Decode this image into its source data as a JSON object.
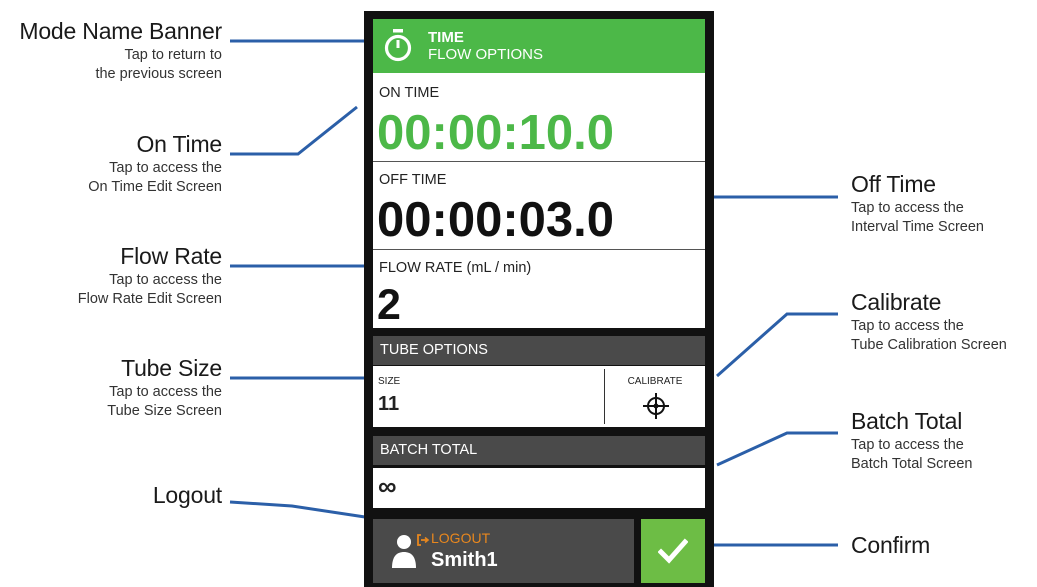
{
  "device": {
    "banner": {
      "mode": "TIME",
      "subtitle": "FLOW OPTIONS",
      "icon": "stopwatch-icon"
    },
    "on_time": {
      "label": "ON TIME",
      "value": "00:00:10.0",
      "color": "#4cb848"
    },
    "off_time": {
      "label": "OFF TIME",
      "value": "00:00:03.0"
    },
    "flow_rate": {
      "label": "FLOW RATE (mL / min)",
      "value": "2"
    },
    "tube_options": {
      "header": "TUBE OPTIONS",
      "size_label": "SIZE",
      "size_value": "11",
      "calibrate_label": "CALIBRATE",
      "calibrate_icon": "crosshair-icon"
    },
    "batch_total": {
      "header": "BATCH TOTAL",
      "value": "∞"
    },
    "logout": {
      "label": "LOGOUT",
      "user": "Smith1",
      "icon": "user-logout-icon",
      "label_color": "#e8871e"
    },
    "confirm": {
      "icon": "checkmark-icon",
      "color": "#6dbd45"
    }
  },
  "callouts": {
    "mode_banner": {
      "title": "Mode Name Banner",
      "line1": "Tap to return to",
      "line2": "the previous screen"
    },
    "on_time": {
      "title": "On Time",
      "line1": "Tap to access the",
      "line2": "On Time Edit Screen"
    },
    "flow_rate": {
      "title": "Flow Rate",
      "line1": "Tap to access the",
      "line2": "Flow Rate Edit Screen"
    },
    "tube_size": {
      "title": "Tube Size",
      "line1": "Tap to access the",
      "line2": "Tube Size Screen"
    },
    "logout": {
      "title": "Logout"
    },
    "off_time": {
      "title": "Off Time",
      "line1": "Tap to access the",
      "line2": "Interval Time Screen"
    },
    "calibrate": {
      "title": "Calibrate",
      "line1": "Tap to access the",
      "line2": "Tube Calibration Screen"
    },
    "batch_total": {
      "title": "Batch Total",
      "line1": "Tap to access the",
      "line2": "Batch Total Screen"
    },
    "confirm": {
      "title": "Confirm"
    }
  },
  "connector_color": "#2b5fa8"
}
